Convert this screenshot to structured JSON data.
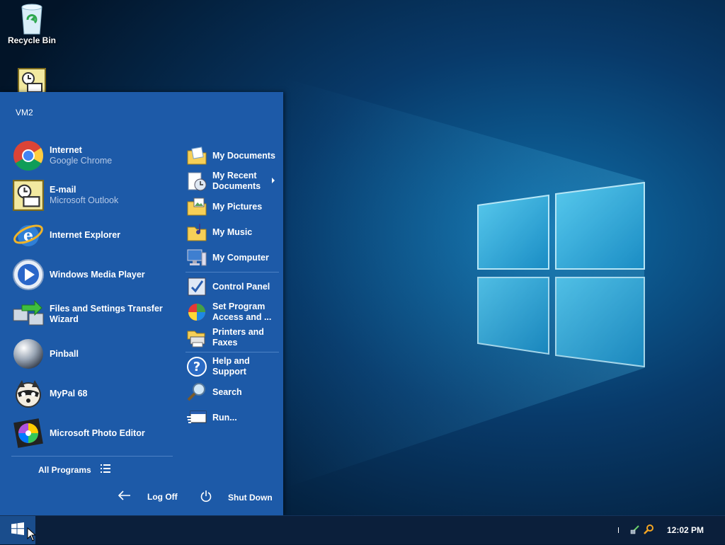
{
  "desktop": {
    "recycle_bin_label": "Recycle Bin"
  },
  "start_menu": {
    "username": "VM2",
    "pinned": [
      {
        "title": "Internet",
        "subtitle": "Google Chrome",
        "icon": "chrome-icon"
      },
      {
        "title": "E-mail",
        "subtitle": "Microsoft Outlook",
        "icon": "outlook-icon"
      }
    ],
    "recent": [
      {
        "title": "Internet Explorer",
        "icon": "internet-explorer-icon"
      },
      {
        "title": "Windows Media Player",
        "icon": "media-player-icon"
      },
      {
        "title": "Files and Settings Transfer Wizard",
        "icon": "transfer-wizard-icon"
      },
      {
        "title": "Pinball",
        "icon": "pinball-icon"
      },
      {
        "title": "MyPal 68",
        "icon": "mypal-icon"
      },
      {
        "title": "Microsoft Photo Editor",
        "icon": "photo-editor-icon"
      }
    ],
    "all_programs_label": "All Programs",
    "right_items": [
      {
        "label": "My Documents",
        "icon": "documents-folder-icon"
      },
      {
        "label": "My Recent Documents",
        "icon": "recent-documents-icon"
      },
      {
        "label": "My Pictures",
        "icon": "pictures-folder-icon"
      },
      {
        "label": "My Music",
        "icon": "music-folder-icon"
      },
      {
        "label": "My Computer",
        "icon": "computer-icon"
      },
      {
        "label": "Control Panel",
        "icon": "control-panel-icon"
      },
      {
        "label": "Set Program Access and ...",
        "icon": "program-access-icon"
      },
      {
        "label": "Printers and Faxes",
        "icon": "printer-icon"
      },
      {
        "label": "Help and Support",
        "icon": "help-icon"
      },
      {
        "label": "Search",
        "icon": "search-icon"
      },
      {
        "label": "Run...",
        "icon": "run-icon"
      }
    ],
    "log_off_label": "Log Off",
    "shut_down_label": "Shut Down"
  },
  "taskbar": {
    "clock": "12:02 PM"
  },
  "colors": {
    "menu_bg": "#1d5aa8",
    "taskbar_bg": "#0b1f3b",
    "subtitle": "#b6c9e6"
  }
}
